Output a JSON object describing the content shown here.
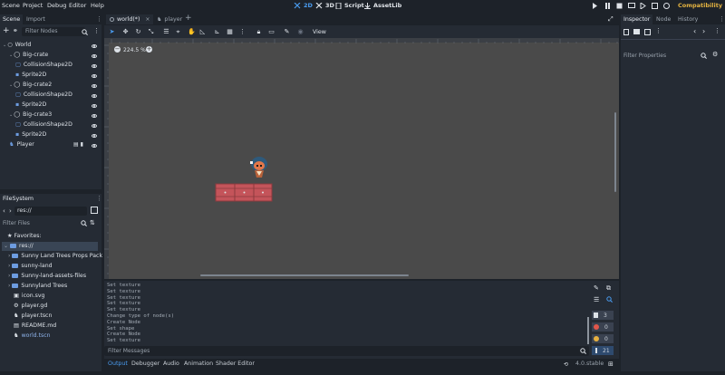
{
  "menu": [
    "Scene",
    "Project",
    "Debug",
    "Editor",
    "Help"
  ],
  "workspaces": [
    "2D",
    "3D",
    "Script",
    "AssetLib"
  ],
  "renderer": "Compatibility",
  "scene_dock": {
    "tabs": [
      "Scene",
      "Import"
    ],
    "filter_placeholder": "Filter Nodes",
    "nodes": [
      {
        "label": "World",
        "depth": 0
      },
      {
        "label": "Big-crate",
        "depth": 1
      },
      {
        "label": "CollisionShape2D",
        "depth": 2
      },
      {
        "label": "Sprite2D",
        "depth": 2
      },
      {
        "label": "Big-crate2",
        "depth": 1
      },
      {
        "label": "CollisionShape2D",
        "depth": 2
      },
      {
        "label": "Sprite2D",
        "depth": 2
      },
      {
        "label": "Big-crate3",
        "depth": 1
      },
      {
        "label": "CollisionShape2D",
        "depth": 2
      },
      {
        "label": "Sprite2D",
        "depth": 2
      },
      {
        "label": "Player",
        "depth": 1
      }
    ]
  },
  "filesystem": {
    "title": "FileSystem",
    "path": "res://",
    "filter_placeholder": "Filter Files",
    "favorites": "Favorites:",
    "items": [
      {
        "label": "res://",
        "type": "folder",
        "depth": 0
      },
      {
        "label": "Sunny Land Trees Props Pack",
        "type": "folder",
        "depth": 1
      },
      {
        "label": "sunny-land",
        "type": "folder",
        "depth": 1
      },
      {
        "label": "Sunny-land-assets-files",
        "type": "folder",
        "depth": 1
      },
      {
        "label": "Sunnyland Trees",
        "type": "folder",
        "depth": 1
      },
      {
        "label": "icon.svg",
        "type": "image",
        "depth": 1
      },
      {
        "label": "player.gd",
        "type": "script",
        "depth": 1
      },
      {
        "label": "player.tscn",
        "type": "scene",
        "depth": 1
      },
      {
        "label": "README.md",
        "type": "text",
        "depth": 1
      },
      {
        "label": "world.tscn",
        "type": "scene",
        "depth": 1
      }
    ]
  },
  "editor_tabs": [
    "world(*)",
    "player"
  ],
  "viewport": {
    "zoom": "224.5 %",
    "view_label": "View"
  },
  "output": {
    "lines": [
      "Set texture",
      "Set texture",
      "Set texture",
      "Set texture",
      "Set texture",
      "Change type of node(s)",
      "Create Node",
      "Set shape",
      "Create Node",
      "Set texture"
    ],
    "filter_placeholder": "Filter Messages",
    "counts": {
      "messages": "3",
      "errors": "0",
      "warnings": "0",
      "info": "21"
    }
  },
  "bottom_tabs": [
    "Output",
    "Debugger",
    "Audio",
    "Animation",
    "Shader Editor"
  ],
  "version": "4.0.stable",
  "inspector": {
    "tabs": [
      "Inspector",
      "Node",
      "History"
    ],
    "filter_placeholder": "Filter Properties"
  },
  "colors": {
    "accent": "#4a9cf0",
    "bg_dark": "#1d2229",
    "panel": "#252b34",
    "viewport": "#4a4a4a",
    "crate": "#c4545a",
    "error": "#e2564a",
    "warning": "#e6b040"
  }
}
